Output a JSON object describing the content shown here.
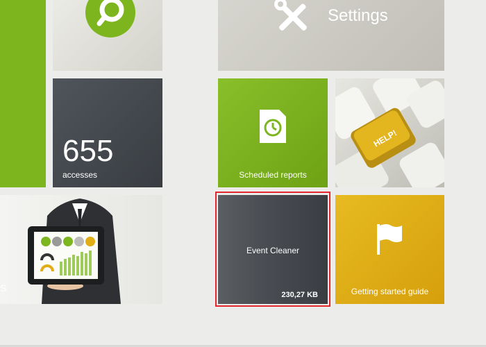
{
  "tiles": {
    "settings": {
      "label": "Settings"
    },
    "accesses": {
      "count": "655",
      "label": "accesses"
    },
    "scheduled_reports": {
      "label": "Scheduled reports"
    },
    "help": {
      "key_label": "HELP!"
    },
    "business": {
      "partial_label": "S"
    },
    "event_cleaner": {
      "title": "Event Cleaner",
      "size": "230,27 KB"
    },
    "getting_started": {
      "label": "Getting started guide"
    }
  },
  "colors": {
    "green": "#7cb51d",
    "dark": "#3a3e43",
    "yellow": "#e0ae14",
    "selection_outline": "#e3262b",
    "background": "#ececeb"
  },
  "icons": [
    "search-logo-icon",
    "tools-icon",
    "clock-document-icon",
    "flag-icon"
  ]
}
